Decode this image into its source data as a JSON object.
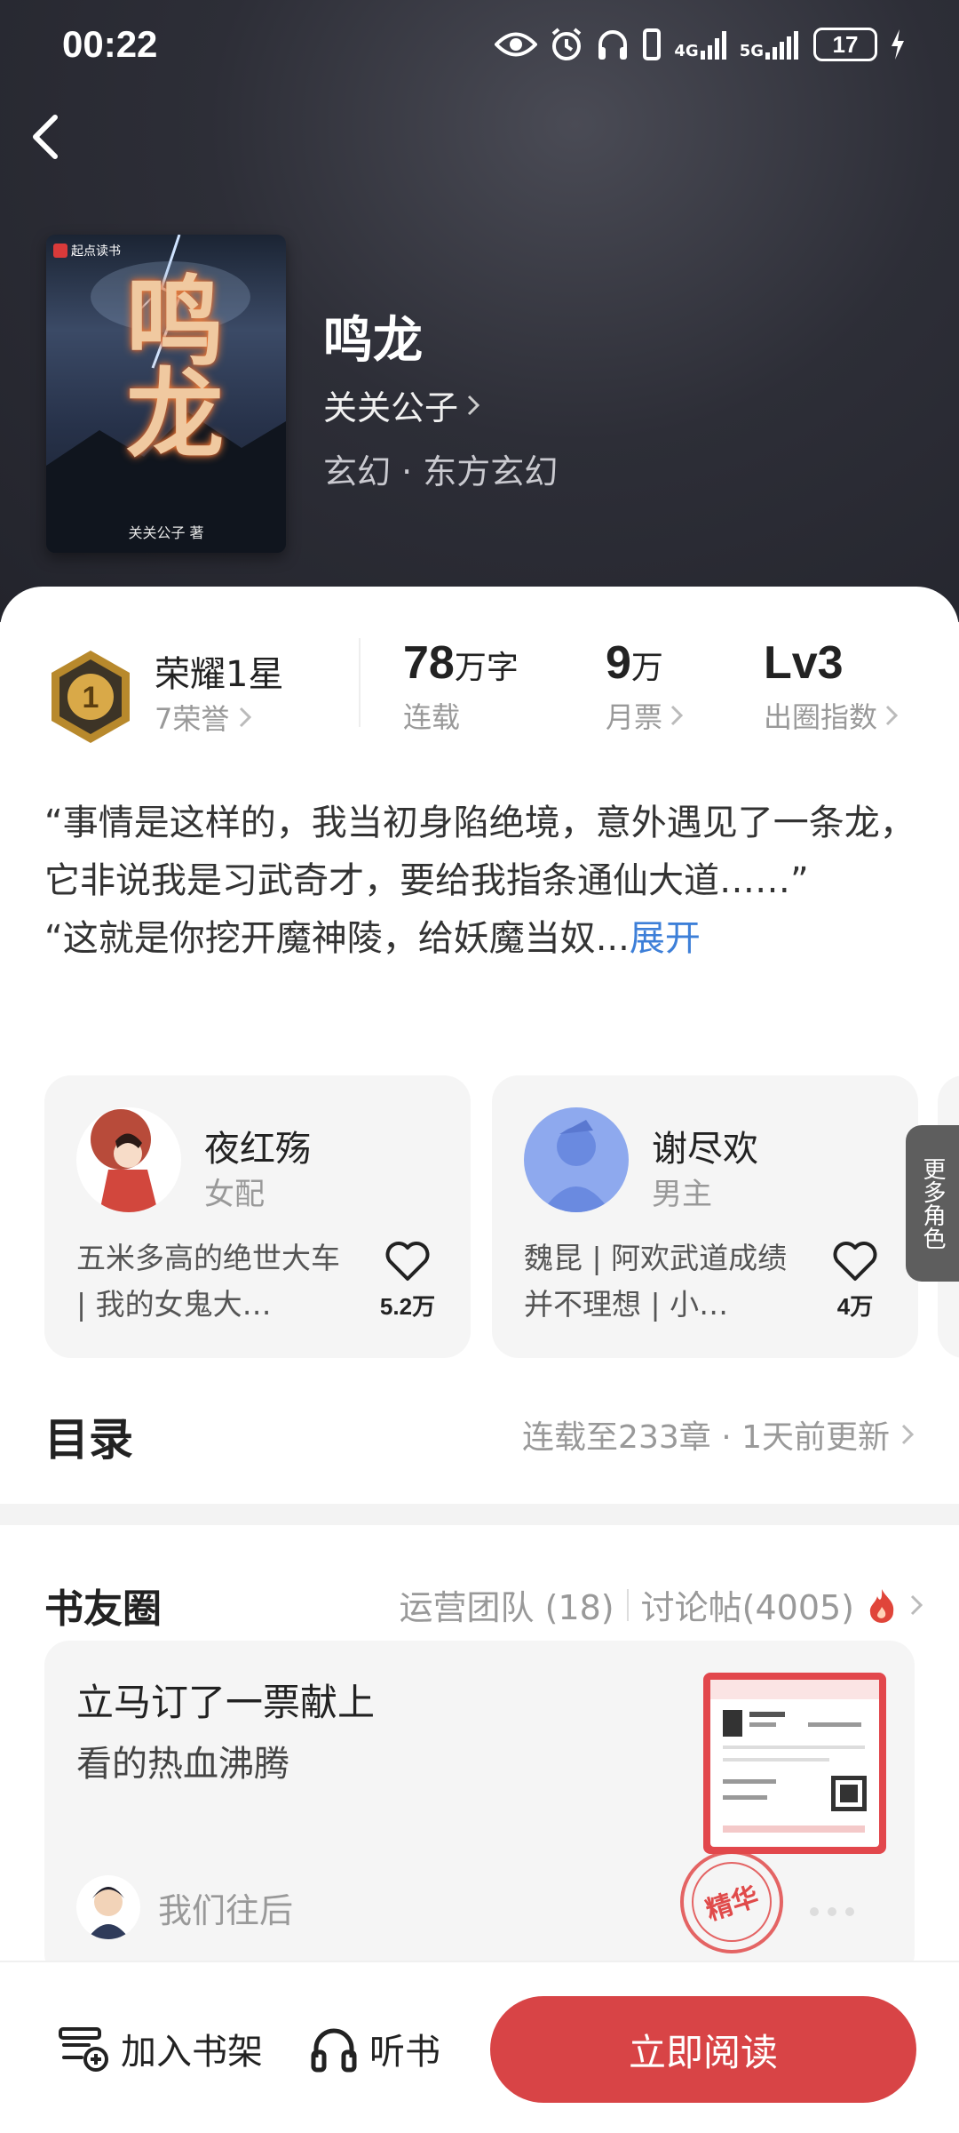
{
  "status_bar": {
    "time": "00:22",
    "net1": "4G",
    "net2": "5G",
    "battery": "17"
  },
  "book": {
    "title": "鸣龙",
    "author": "关关公子",
    "genre": "玄幻 · 东方玄幻",
    "cover_brand": "起点读书",
    "cover_title": "鸣龙",
    "cover_author": "关关公子 著"
  },
  "stats": {
    "honor_title": "荣耀1星",
    "honor_sub": "7荣誉",
    "honor_badge_number": "1",
    "words_num": "78",
    "words_unit": "万字",
    "words_label": "连载",
    "tickets_num": "9",
    "tickets_unit": "万",
    "tickets_label": "月票",
    "level_num": "Lv3",
    "level_label": "出圈指数"
  },
  "synopsis": {
    "text": "“事情是这样的，我当初身陷绝境，意外遇见了一条龙，它非说我是习武奇才，要给我指条通仙大道……”\n“这就是你挖开魔神陵，给妖魔当奴...",
    "expand": "展开"
  },
  "characters": [
    {
      "name": "夜红殇",
      "role": "女配",
      "desc": "五米多高的绝世大车 | 我的女鬼大…",
      "likes": "5.2万"
    },
    {
      "name": "谢尽欢",
      "role": "男主",
      "desc": "魏昆 | 阿欢武道成绩并不理想 | 小…",
      "likes": "4万"
    }
  ],
  "more_roles": "更多角色",
  "toc": {
    "title": "目录",
    "info": "连载至233章 · 1天前更新"
  },
  "circle": {
    "title": "书友圈",
    "team": "运营团队 (18)",
    "posts": "讨论帖(4005)",
    "post": {
      "title": "立马订了一票献上",
      "body": "看的热血沸腾",
      "user": "我们往后",
      "stamp": "精华"
    }
  },
  "bottom": {
    "shelf": "加入书架",
    "listen": "听书",
    "read": "立即阅读"
  },
  "colors": {
    "accent": "#d84446",
    "link": "#3d7fd8",
    "hero_bg": "#2d2e37"
  }
}
